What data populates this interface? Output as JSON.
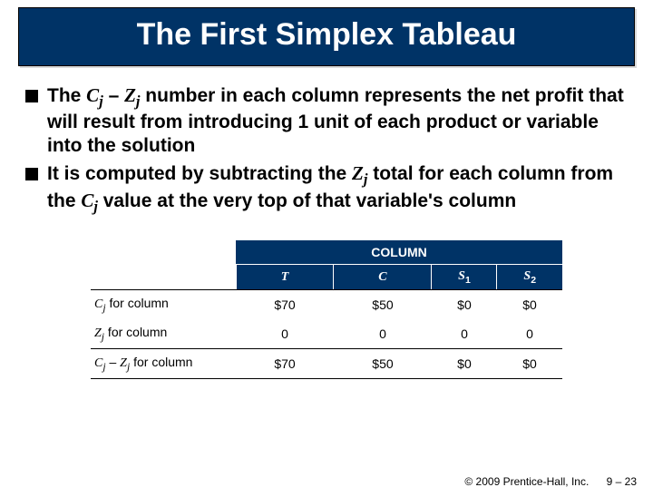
{
  "title": "The First Simplex Tableau",
  "bullets": {
    "b1_pre": "The ",
    "b1_cj": "C",
    "b1_j1": "j",
    "b1_minus": " – ",
    "b1_zj": "Z",
    "b1_j2": "j",
    "b1_post": " number in each column represents the net profit that will result from introducing 1 unit of each product or variable into the solution",
    "b2_pre": "It is computed by subtracting the ",
    "b2_zj": "Z",
    "b2_j1": "j",
    "b2_mid": " total for each column from the ",
    "b2_cj": "C",
    "b2_j2": "j",
    "b2_post": " value at the very top of that variable's column"
  },
  "table": {
    "column_group": "COLUMN",
    "headers": {
      "h1": "T",
      "h2": "C",
      "h3": "S",
      "h3s": "1",
      "h4": "S",
      "h4s": "2"
    },
    "rows": {
      "r1": {
        "label_i": "C",
        "label_s": "j",
        "label_t": " for column",
        "v1": "$70",
        "v2": "$50",
        "v3": "$0",
        "v4": "$0"
      },
      "r2": {
        "label_i": "Z",
        "label_s": "j",
        "label_t": " for column",
        "v1": "0",
        "v2": "0",
        "v3": "0",
        "v4": "0"
      },
      "r3": {
        "label_i1": "C",
        "label_s1": "j",
        "label_m": " – ",
        "label_i2": "Z",
        "label_s2": "j",
        "label_t": " for column",
        "v1": "$70",
        "v2": "$50",
        "v3": "$0",
        "v4": "$0"
      }
    }
  },
  "footer": {
    "copyright": "© 2009 Prentice-Hall, Inc.",
    "page": "9 – 23"
  },
  "chart_data": {
    "type": "table",
    "title": "The First Simplex Tableau",
    "columns": [
      "T",
      "C",
      "S1",
      "S2"
    ],
    "rows": [
      {
        "label": "Cj for column",
        "values": [
          70,
          50,
          0,
          0
        ],
        "unit": "$"
      },
      {
        "label": "Zj for column",
        "values": [
          0,
          0,
          0,
          0
        ],
        "unit": ""
      },
      {
        "label": "Cj – Zj for column",
        "values": [
          70,
          50,
          0,
          0
        ],
        "unit": "$"
      }
    ]
  }
}
